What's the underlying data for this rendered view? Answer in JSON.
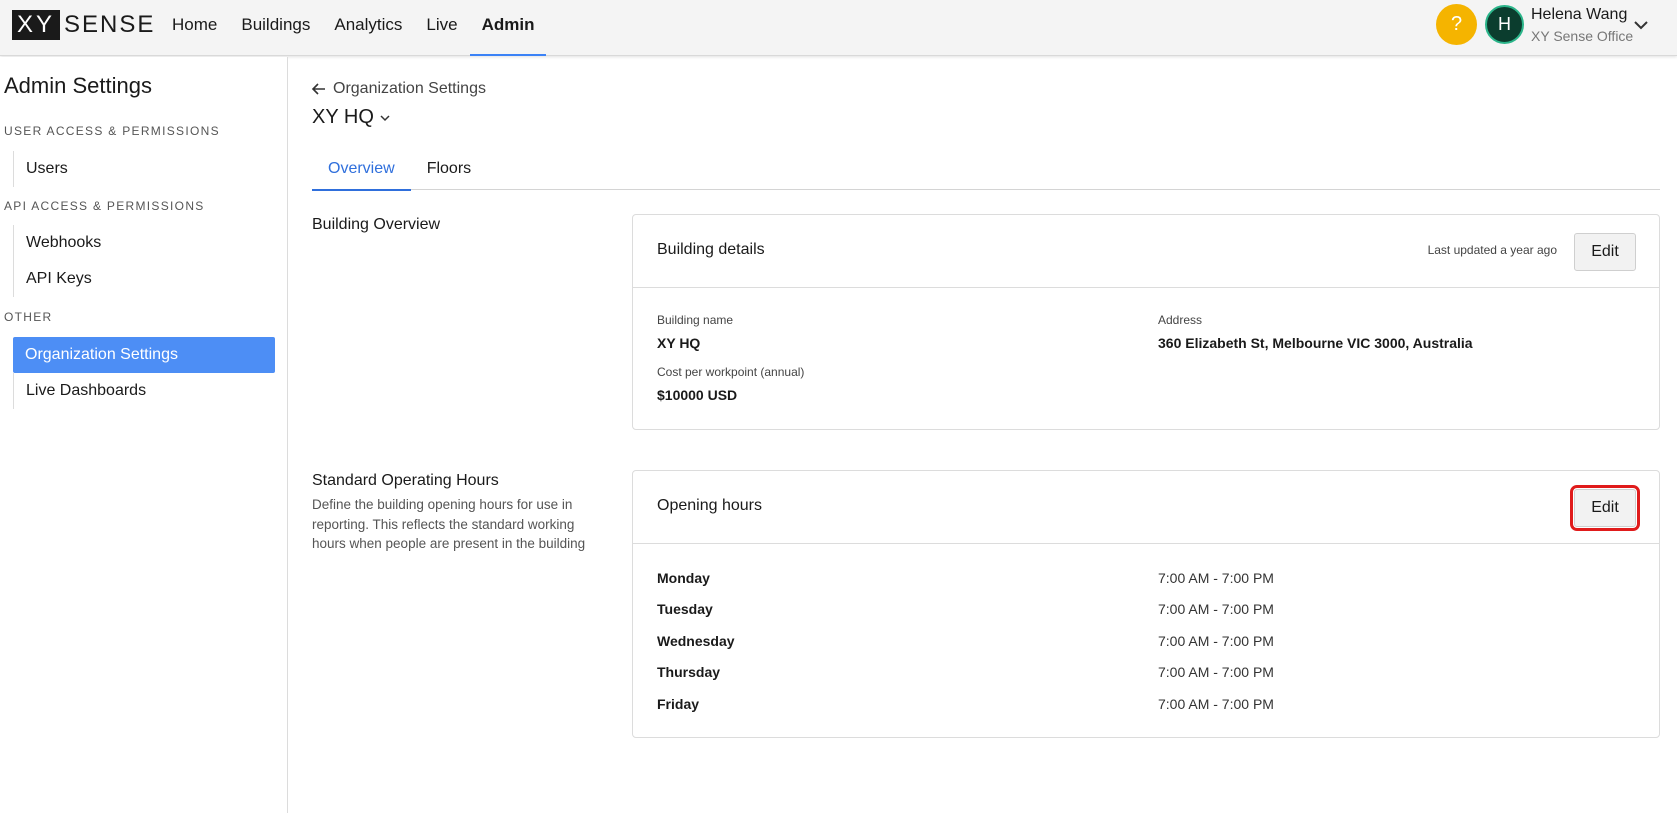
{
  "logo": {
    "xy": "XY",
    "sense": "SENSE"
  },
  "nav": {
    "items": [
      {
        "label": "Home"
      },
      {
        "label": "Buildings"
      },
      {
        "label": "Analytics"
      },
      {
        "label": "Live"
      },
      {
        "label": "Admin",
        "active": true
      }
    ]
  },
  "user": {
    "help_label": "?",
    "initial": "H",
    "name": "Helena Wang",
    "org": "XY Sense Office"
  },
  "sidebar": {
    "title": "Admin Settings",
    "sections": [
      {
        "label": "USER ACCESS & PERMISSIONS",
        "items": [
          {
            "label": "Users"
          }
        ]
      },
      {
        "label": "API ACCESS & PERMISSIONS",
        "items": [
          {
            "label": "Webhooks"
          },
          {
            "label": "API Keys"
          }
        ]
      },
      {
        "label": "OTHER",
        "items": [
          {
            "label": "Organization Settings",
            "active": true
          },
          {
            "label": "Live Dashboards"
          }
        ]
      }
    ]
  },
  "page": {
    "back_label": "Organization Settings",
    "building_select": "XY HQ",
    "tabs": [
      {
        "label": "Overview",
        "active": true
      },
      {
        "label": "Floors"
      }
    ]
  },
  "overview": {
    "section_title": "Building Overview",
    "card_title": "Building details",
    "last_updated": "Last updated a year ago",
    "edit_label": "Edit",
    "fields": {
      "building_name_label": "Building name",
      "building_name_value": "XY HQ",
      "address_label": "Address",
      "address_value": "360 Elizabeth St, Melbourne VIC 3000, Australia",
      "cost_label": "Cost per workpoint (annual)",
      "cost_value": "$10000 USD"
    }
  },
  "hours": {
    "section_title": "Standard Operating Hours",
    "section_desc": "Define the building opening hours for use in reporting. This reflects the standard working hours when people are present in the building",
    "card_title": "Opening hours",
    "edit_label": "Edit",
    "rows": [
      {
        "day": "Monday",
        "time": "7:00 AM - 7:00 PM"
      },
      {
        "day": "Tuesday",
        "time": "7:00 AM - 7:00 PM"
      },
      {
        "day": "Wednesday",
        "time": "7:00 AM - 7:00 PM"
      },
      {
        "day": "Thursday",
        "time": "7:00 AM - 7:00 PM"
      },
      {
        "day": "Friday",
        "time": "7:00 AM - 7:00 PM"
      }
    ]
  },
  "colors": {
    "accent": "#2f6fdc",
    "sidebar_active": "#4d8ef5",
    "help": "#f5b400",
    "avatar_bg": "#0b3d2e",
    "highlight": "#e01b1b"
  }
}
